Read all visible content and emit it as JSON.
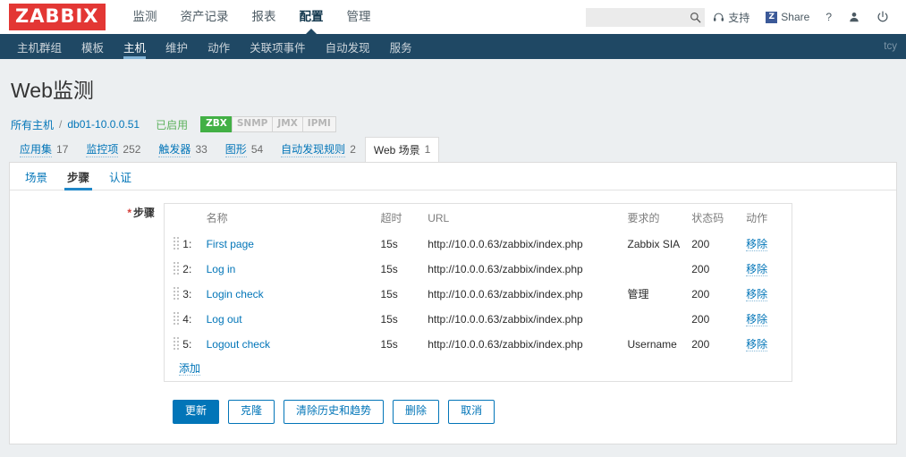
{
  "brand": {
    "logo_text": "ZABBIX",
    "logo_bg": "#e33734"
  },
  "topmenu": {
    "items": [
      {
        "label": "监测",
        "active": false
      },
      {
        "label": "资产记录",
        "active": false
      },
      {
        "label": "报表",
        "active": false
      },
      {
        "label": "配置",
        "active": true
      },
      {
        "label": "管理",
        "active": false
      }
    ]
  },
  "topright": {
    "search_value": "",
    "search_placeholder": "",
    "support_label": "支持",
    "share_label": "Share",
    "share_badge": "Z",
    "help_label": "?"
  },
  "subnav": {
    "items": [
      {
        "label": "主机群组",
        "active": false
      },
      {
        "label": "模板",
        "active": false
      },
      {
        "label": "主机",
        "active": true
      },
      {
        "label": "维护",
        "active": false
      },
      {
        "label": "动作",
        "active": false
      },
      {
        "label": "关联项事件",
        "active": false
      },
      {
        "label": "自动发现",
        "active": false
      },
      {
        "label": "服务",
        "active": false
      }
    ],
    "user": "tcy",
    "bg": "#1f4864"
  },
  "page": {
    "title": "Web监测"
  },
  "breadcrumb": {
    "all_hosts": "所有主机",
    "separator": "/",
    "host": "db01-10.0.0.51",
    "status": "已启用",
    "interfaces": [
      {
        "label": "ZBX",
        "enabled": true
      },
      {
        "label": "SNMP",
        "enabled": false
      },
      {
        "label": "JMX",
        "enabled": false
      },
      {
        "label": "IPMI",
        "enabled": false
      }
    ],
    "entities": [
      {
        "label": "应用集",
        "count": "17",
        "selected": false
      },
      {
        "label": "监控项",
        "count": "252",
        "selected": false
      },
      {
        "label": "触发器",
        "count": "33",
        "selected": false
      },
      {
        "label": "图形",
        "count": "54",
        "selected": false
      },
      {
        "label": "自动发现规则",
        "count": "2",
        "selected": false
      },
      {
        "label": "Web 场景",
        "count": "1",
        "selected": true
      }
    ]
  },
  "tabs": [
    {
      "label": "场景",
      "active": false
    },
    {
      "label": "步骤",
      "active": true
    },
    {
      "label": "认证",
      "active": false
    }
  ],
  "form": {
    "steps_label": "步骤",
    "required_mark": "*",
    "add_label": "添加",
    "columns": [
      "名称",
      "超时",
      "URL",
      "要求的",
      "状态码",
      "动作"
    ],
    "action_label": "移除",
    "rows": [
      {
        "num": "1:",
        "name": "First page",
        "timeout": "15s",
        "url": "http://10.0.0.63/zabbix/index.php",
        "required": "Zabbix SIA",
        "status": "200",
        "action": "移除"
      },
      {
        "num": "2:",
        "name": "Log in",
        "timeout": "15s",
        "url": "http://10.0.0.63/zabbix/index.php",
        "required": "",
        "status": "200",
        "action": "移除"
      },
      {
        "num": "3:",
        "name": "Login check",
        "timeout": "15s",
        "url": "http://10.0.0.63/zabbix/index.php",
        "required": "管理",
        "status": "200",
        "action": "移除"
      },
      {
        "num": "4:",
        "name": "Log out",
        "timeout": "15s",
        "url": "http://10.0.0.63/zabbix/index.php",
        "required": "",
        "status": "200",
        "action": "移除"
      },
      {
        "num": "5:",
        "name": "Logout check",
        "timeout": "15s",
        "url": "http://10.0.0.63/zabbix/index.php",
        "required": "Username",
        "status": "200",
        "action": "移除"
      }
    ]
  },
  "buttons": [
    {
      "label": "更新",
      "kind": "primary"
    },
    {
      "label": "克隆",
      "kind": "ghost"
    },
    {
      "label": "清除历史和趋势",
      "kind": "ghost"
    },
    {
      "label": "删除",
      "kind": "ghost"
    },
    {
      "label": "取消",
      "kind": "ghost"
    }
  ],
  "colors": {
    "accent": "#0275b8",
    "navy": "#1f4864",
    "red": "#e33734",
    "green": "#42b045"
  }
}
